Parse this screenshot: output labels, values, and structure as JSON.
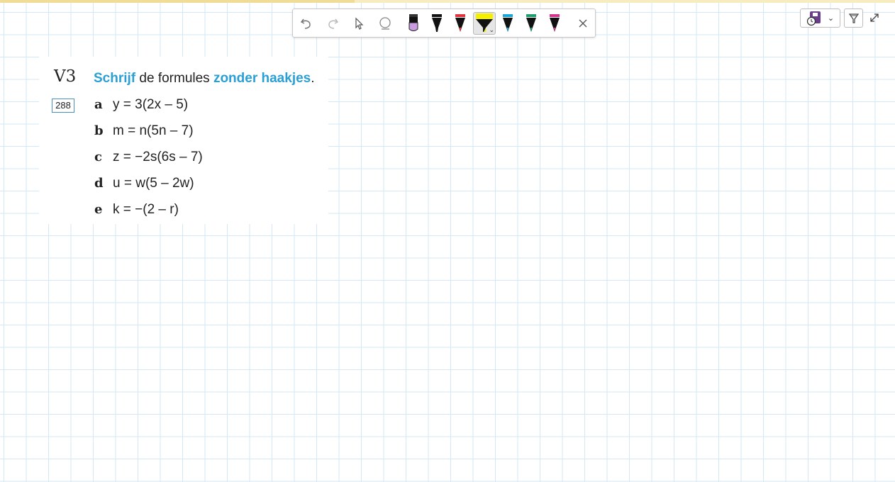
{
  "toolbar": {
    "tools": [
      {
        "name": "undo-icon"
      },
      {
        "name": "redo-icon"
      },
      {
        "name": "pointer-icon"
      },
      {
        "name": "eraser-icon"
      },
      {
        "name": "marker-purple-icon",
        "color": "#c99be0"
      },
      {
        "name": "marker-black-icon",
        "color": "#111111"
      },
      {
        "name": "marker-red-icon",
        "color": "#e2333c"
      },
      {
        "name": "highlighter-yellow-icon",
        "color": "#f4f000",
        "selected": true
      },
      {
        "name": "marker-blue-icon",
        "color": "#18a5d8"
      },
      {
        "name": "marker-green-icon",
        "color": "#1e9e6a"
      },
      {
        "name": "marker-magenta-icon",
        "color": "#d6338a"
      },
      {
        "name": "close-icon"
      }
    ]
  },
  "controls": {
    "save_icon": "save-clock-icon",
    "filter_icon": "filter-icon",
    "expand_icon": "expand-icon"
  },
  "exercise": {
    "number": "V3",
    "page_ref": "288",
    "instruction": {
      "part1": "Schrijf",
      "part2": " de formules ",
      "part3": "zonder haakjes",
      "part4": "."
    },
    "items": [
      {
        "letter": "a",
        "formula": "y = 3(2x – 5)"
      },
      {
        "letter": "b",
        "formula": "m = n(5n – 7)"
      },
      {
        "letter": "c",
        "formula": "z = −2s(6s – 7)"
      },
      {
        "letter": "d",
        "formula": "u = w(5 – 2w)"
      },
      {
        "letter": "e",
        "formula": "k = −(2 – r)"
      }
    ]
  },
  "colors": {
    "accent": "#2a9fd6",
    "grid": "#d3e7f6",
    "top_strip": "#f7ecc0"
  }
}
